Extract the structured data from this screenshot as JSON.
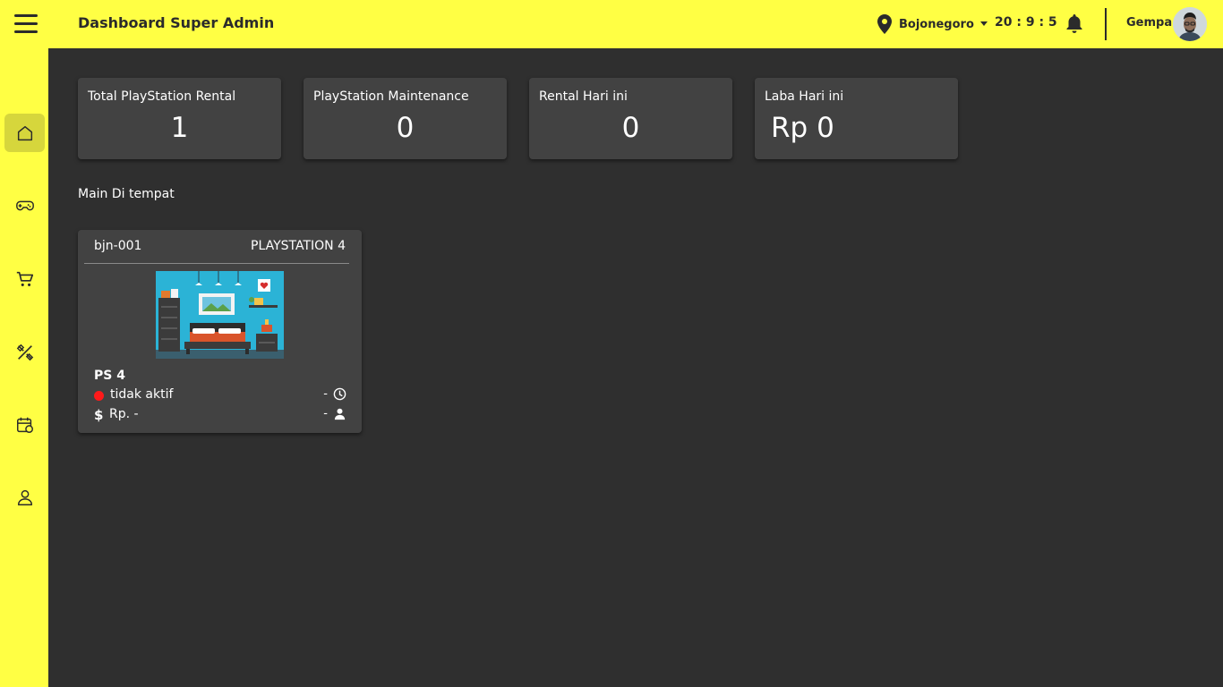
{
  "header": {
    "title": "Dashboard Super Admin",
    "location": "Bojonegoro",
    "clock": "20 : 9 : 5",
    "user_name": "Gempa",
    "accent_color": "#ffff44"
  },
  "sidebar": {
    "items": [
      {
        "icon": "home-icon",
        "active": true
      },
      {
        "icon": "gamepad-icon",
        "active": false
      },
      {
        "icon": "cart-icon",
        "active": false
      },
      {
        "icon": "tools-icon",
        "active": false
      },
      {
        "icon": "report-icon",
        "active": false
      },
      {
        "icon": "user-icon",
        "active": false
      }
    ]
  },
  "stats": [
    {
      "label": "Total PlayStation Rental",
      "value": "1"
    },
    {
      "label": "PlayStation Maintenance",
      "value": "0"
    },
    {
      "label": "Rental Hari ini",
      "value": "0"
    },
    {
      "label": "Laba Hari ini",
      "value": "Rp 0"
    }
  ],
  "section": {
    "title": "Main Di tempat"
  },
  "consoles": [
    {
      "code": "bjn-001",
      "type": "PLAYSTATION 4",
      "name": "PS 4",
      "status": "tidak aktif",
      "status_color": "#ff1a1a",
      "time": "-",
      "price": "Rp. -",
      "user": "-"
    }
  ]
}
